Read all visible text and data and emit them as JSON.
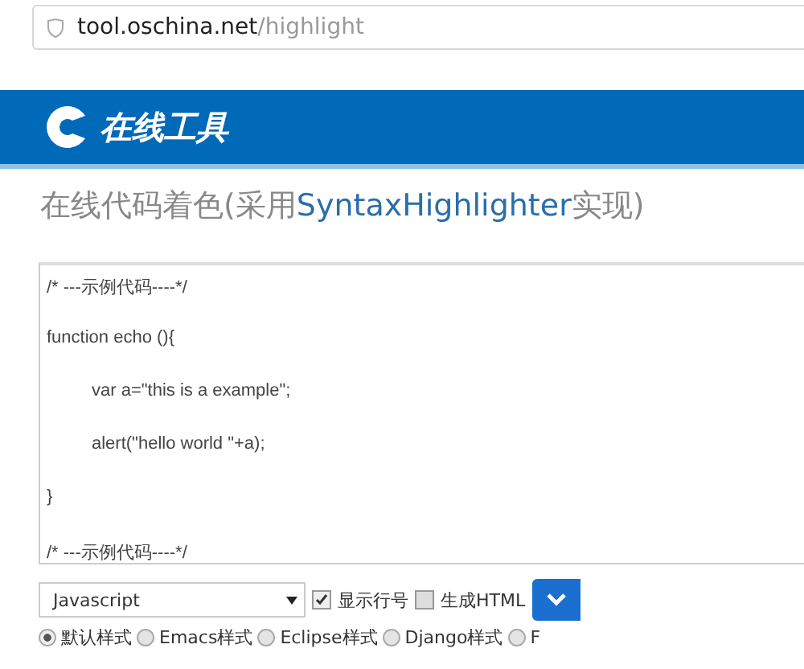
{
  "address_bar": {
    "host": "tool.oschina.net",
    "path": "/highlight"
  },
  "banner": {
    "logo_text": "在线工具"
  },
  "heading": {
    "before": "在线代码着色(采用",
    "highlight": "SyntaxHighlighter",
    "after": "实现)"
  },
  "code_lines": [
    {
      "text": "/* ---示例代码----*/",
      "indented": false
    },
    {
      "text": "function echo (){",
      "indented": false
    },
    {
      "text": "var a=\"this is a example\";",
      "indented": true
    },
    {
      "text": "alert(\"hello world \"+a);",
      "indented": true
    },
    {
      "text": "}",
      "indented": false
    },
    {
      "text": "/* ---示例代码----*/",
      "indented": false
    }
  ],
  "language_select": {
    "value": "Javascript"
  },
  "checkboxes": [
    {
      "label": "显示行号",
      "checked": true
    },
    {
      "label": "生成HTML",
      "checked": false
    }
  ],
  "styles": [
    {
      "label": "默认样式",
      "selected": true
    },
    {
      "label": "Emacs样式",
      "selected": false
    },
    {
      "label": "Eclipse样式",
      "selected": false
    },
    {
      "label": "Django样式",
      "selected": false
    },
    {
      "label": "F",
      "selected": false
    }
  ]
}
